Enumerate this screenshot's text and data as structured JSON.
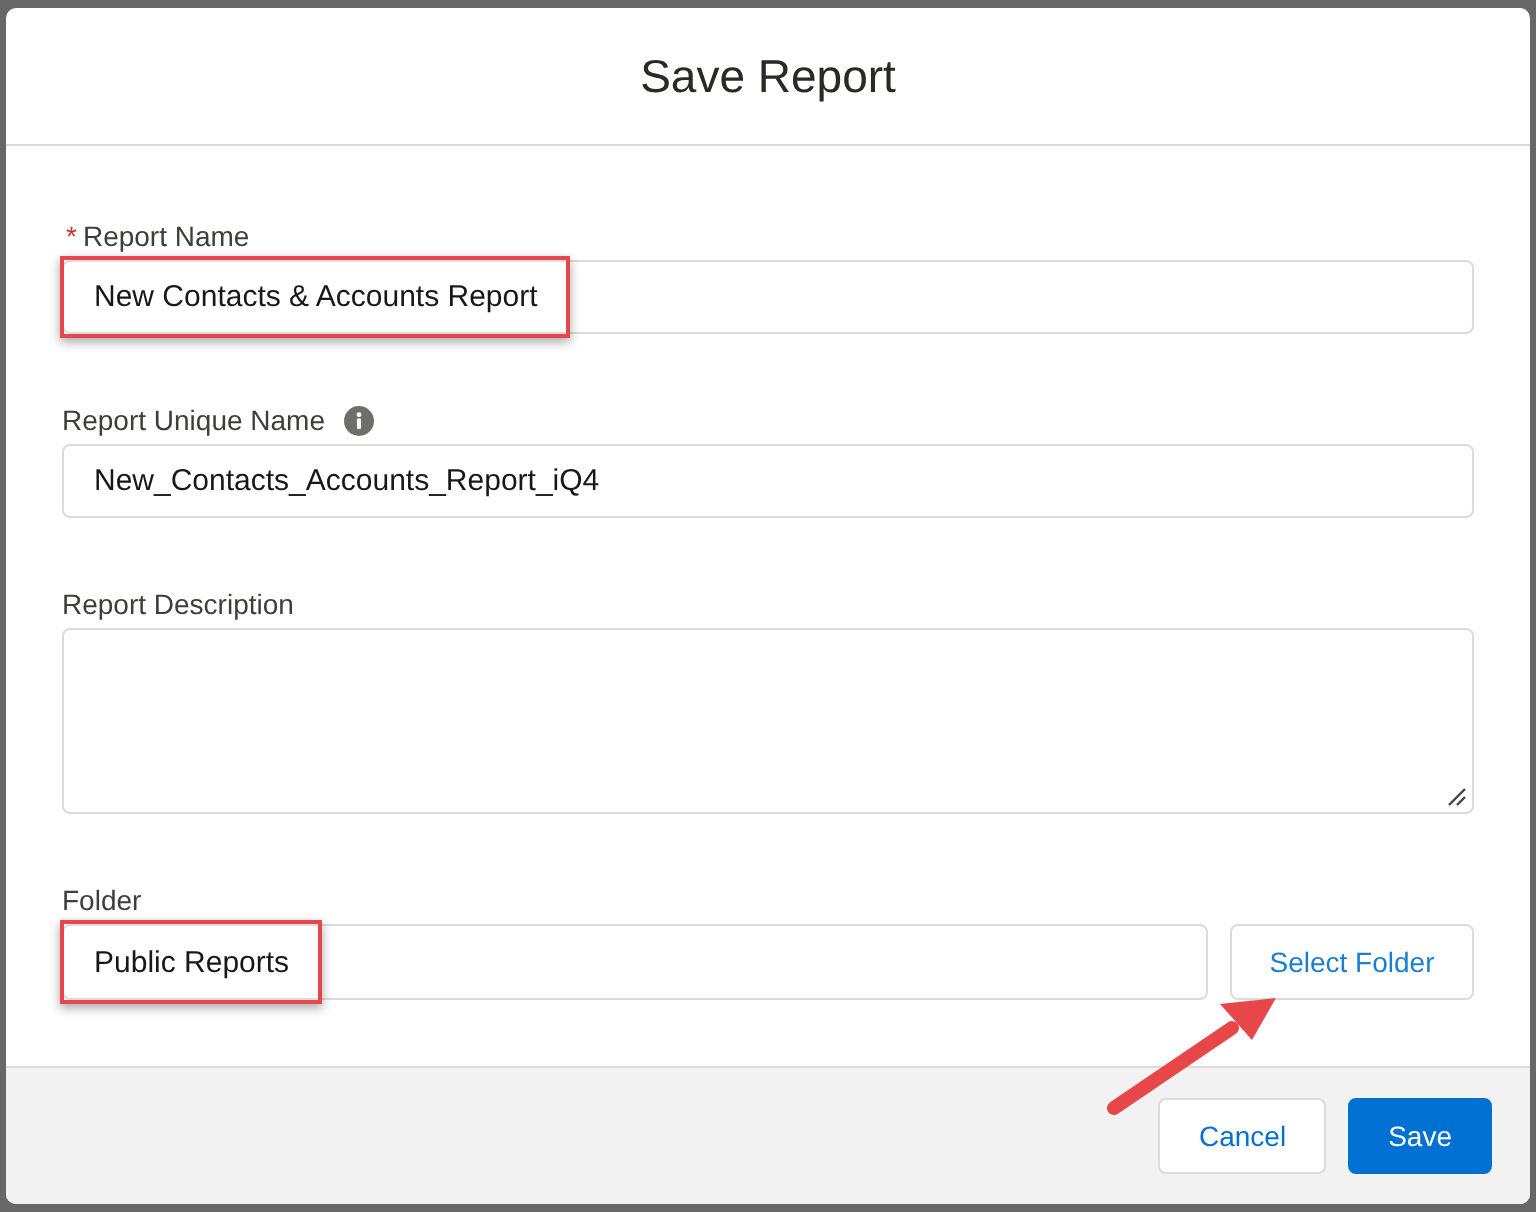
{
  "dialog": {
    "title": "Save Report"
  },
  "fields": [
    {
      "kind": "text",
      "label": "Report Name",
      "required_mark": "*",
      "info": false,
      "value": "New Contacts & Accounts Report",
      "highlighted": true
    },
    {
      "kind": "text",
      "label": "Report Unique Name",
      "info": true,
      "value": "New_Contacts_Accounts_Report_iQ4",
      "highlighted": false
    },
    {
      "kind": "textarea",
      "label": "Report Description",
      "info": false,
      "highlighted": false
    },
    {
      "kind": "picker",
      "label": "Folder",
      "info": false,
      "value": "Public Reports",
      "highlighted": true,
      "button": "Select Folder"
    }
  ],
  "footer": {
    "buttons": [
      {
        "label": "Cancel",
        "kind": "neutral"
      },
      {
        "label": "Save",
        "kind": "brand"
      }
    ]
  }
}
